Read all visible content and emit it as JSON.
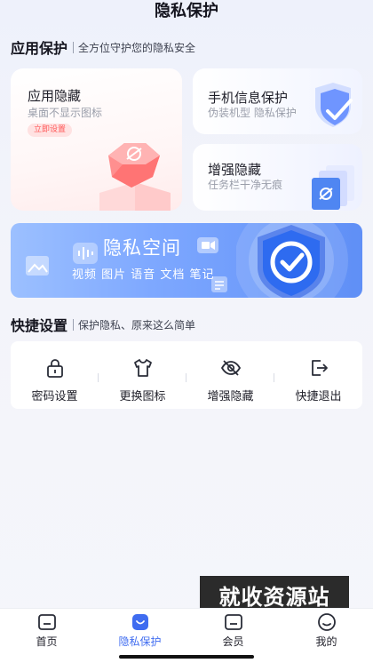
{
  "header": {
    "title": "隐私保护"
  },
  "app_protect": {
    "title": "应用保护",
    "subtitle": "全方位守护您的隐私安全",
    "cards": {
      "hide": {
        "title": "应用隐藏",
        "subtitle": "桌面不显示图标",
        "badge": "立即设置"
      },
      "phone": {
        "title": "手机信息保护",
        "subtitle": "伪装机型 隐私保护"
      },
      "enhance": {
        "title": "增强隐藏",
        "subtitle": "任务栏干净无痕"
      }
    }
  },
  "banner": {
    "title": "隐私空间",
    "subtitle": "视频 图片 语音 文档 笔记"
  },
  "quick_settings": {
    "title": "快捷设置",
    "subtitle": "保护隐私、原来这么简单",
    "items": [
      {
        "label": "密码设置",
        "icon": "lock-icon"
      },
      {
        "label": "更换图标",
        "icon": "shirt-icon"
      },
      {
        "label": "增强隐藏",
        "icon": "eye-off-icon"
      },
      {
        "label": "快捷退出",
        "icon": "exit-icon"
      }
    ]
  },
  "watermark": {
    "text": "就收资源站"
  },
  "tabbar": {
    "items": [
      {
        "label": "首页",
        "icon": "home-icon"
      },
      {
        "label": "隐私保护",
        "icon": "privacy-icon",
        "active": true
      },
      {
        "label": "会员",
        "icon": "vip-icon"
      },
      {
        "label": "我的",
        "icon": "profile-icon"
      }
    ]
  },
  "colors": {
    "accent": "#3f6cf0",
    "badge_bg": "#ffe2e2",
    "badge_text": "#ff5a5a"
  }
}
